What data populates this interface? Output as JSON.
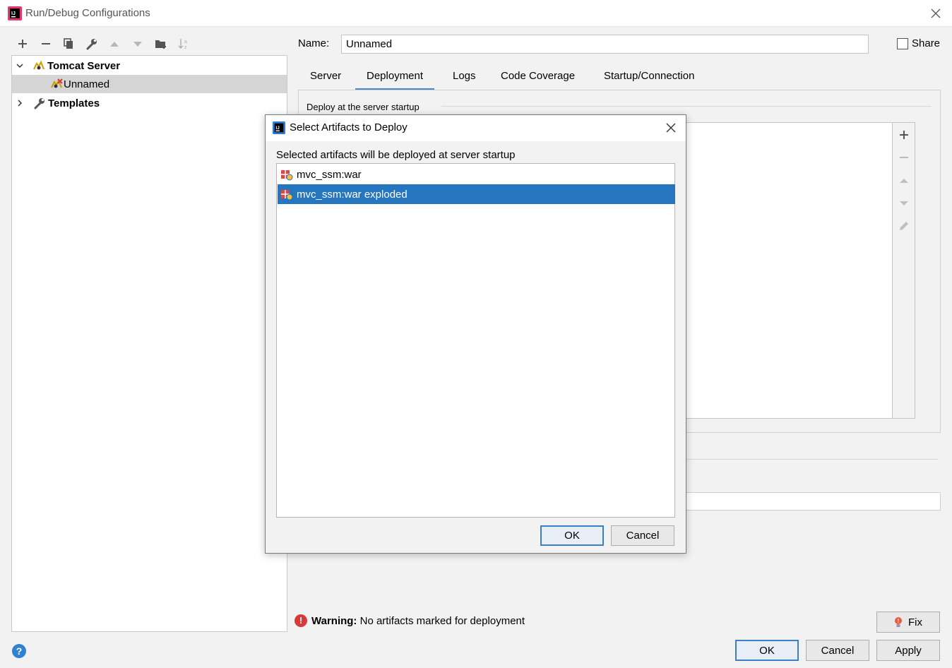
{
  "window": {
    "title": "Run/Debug Configurations"
  },
  "toolbar": {
    "icons": [
      "plus-icon",
      "minus-icon",
      "copy-icon",
      "wrench-icon",
      "arrow-up-icon",
      "arrow-down-icon",
      "folder-add-icon",
      "sort-icon"
    ]
  },
  "tree": {
    "items": [
      {
        "label": "Tomcat Server",
        "expanded": true
      },
      {
        "label": "Unnamed",
        "selected": true
      },
      {
        "label": "Templates",
        "expanded": false
      }
    ]
  },
  "config": {
    "name_label": "Name:",
    "name_value": "Unnamed",
    "share_label": "Share",
    "share_checked": false,
    "tabs": [
      "Server",
      "Deployment",
      "Logs",
      "Code Coverage",
      "Startup/Connection"
    ],
    "active_tab": "Deployment",
    "deploy_legend": "Deploy at the server startup"
  },
  "warning": {
    "bold": "Warning:",
    "text": "No artifacts marked for deployment"
  },
  "buttons": {
    "fix": "Fix",
    "ok": "OK",
    "cancel": "Cancel",
    "apply": "Apply"
  },
  "dialog": {
    "title": "Select Artifacts to Deploy",
    "description": "Selected artifacts will be deployed at server startup",
    "artifacts": [
      {
        "label": "mvc_ssm:war",
        "selected": false
      },
      {
        "label": "mvc_ssm:war exploded",
        "selected": true
      }
    ],
    "ok": "OK",
    "cancel": "Cancel"
  },
  "colors": {
    "selection": "#2675bf",
    "tab_underline": "#4a88c7",
    "warning": "#d63b3b",
    "help": "#2e82d0"
  }
}
